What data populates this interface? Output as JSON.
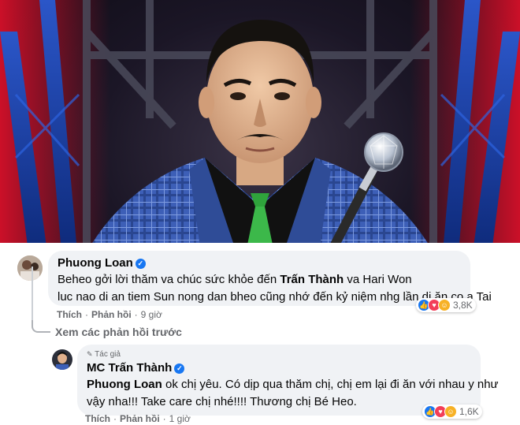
{
  "colors": {
    "fb_blue": "#1877f2",
    "bubble_bg": "#f0f2f5",
    "secondary_text": "#65676b"
  },
  "comment1": {
    "author": "Phuong Loan",
    "line1_prefix": "Beheo gởi lời thăm va chúc sức khỏe đến ",
    "line1_bold": "Trấn Thành",
    "line1_suffix": " va Hari Won",
    "line2": "luc nao di an tiem Sun nong dan bheo cũng nhớ đến kỷ niệm nhg lần di ăn co a Tai",
    "like_label": "Thích",
    "reply_label": "Phản hồi",
    "time": "9 giờ",
    "reaction_count": "3,8K"
  },
  "view_previous": "Xem các phản hồi trước",
  "comment2": {
    "badge": "Tác giả",
    "author": "MC Trấn Thành",
    "mention": "Phuong Loan",
    "line1_rest": " ok chị yêu. Có dịp qua thăm chị, chị em lại đi ăn với nhau y như",
    "line2": "vậy nha!!! Take care chị nhé!!!! Thương chị Bé Heo.",
    "like_label": "Thích",
    "reply_label": "Phản hồi",
    "time": "1 giờ",
    "reaction_count": "1,6K"
  },
  "icons": {
    "verified": "verified-badge-icon",
    "author_badge": "pencil-icon",
    "like": "like-reaction-icon",
    "love": "love-reaction-icon",
    "care": "care-reaction-icon"
  }
}
